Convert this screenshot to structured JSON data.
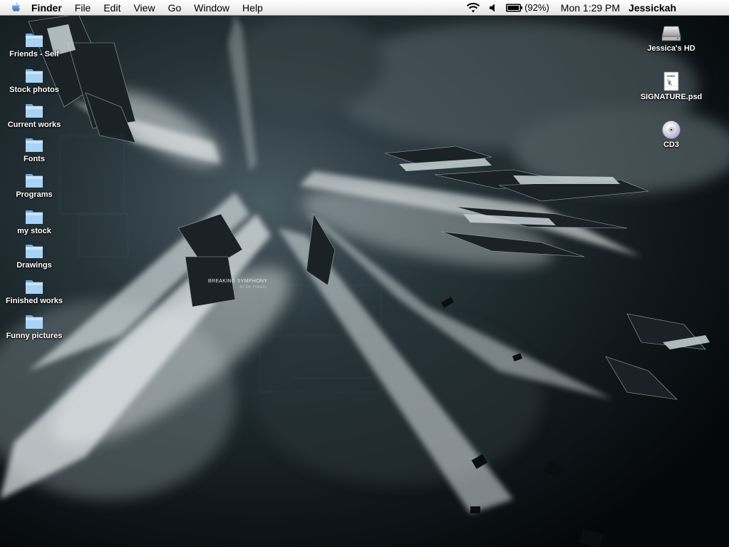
{
  "menubar": {
    "app_name": "Finder",
    "menus": [
      "File",
      "Edit",
      "View",
      "Go",
      "Window",
      "Help"
    ],
    "battery_percent": "(92%)",
    "clock": "Mon 1:29 PM",
    "user": "Jessickah",
    "icons": [
      "apple-icon",
      "wifi-icon",
      "volume-icon",
      "battery-icon"
    ]
  },
  "desktop": {
    "left_folders": [
      {
        "label": "Friends - Self"
      },
      {
        "label": "Stock photos"
      },
      {
        "label": "Current works"
      },
      {
        "label": "Fonts"
      },
      {
        "label": "Programs"
      },
      {
        "label": "my stock"
      },
      {
        "label": "Drawings"
      },
      {
        "label": "Finished works"
      },
      {
        "label": "Funny pictures"
      }
    ],
    "right_items": [
      {
        "label": "Jessica's HD",
        "icon": "hard-drive-icon"
      },
      {
        "label": "SIGNATURE.psd",
        "icon": "psd-document-icon"
      },
      {
        "label": "CD3",
        "icon": "cd-icon"
      }
    ]
  },
  "wallpaper": {
    "caption": "BREAKING SYMPHONY",
    "subcaption": "BY EK.TYRAEL"
  },
  "colors": {
    "wallpaper_dark": "#0b1014",
    "wallpaper_light": "#e8eef0",
    "folder_blue": "#9ccbf2"
  }
}
